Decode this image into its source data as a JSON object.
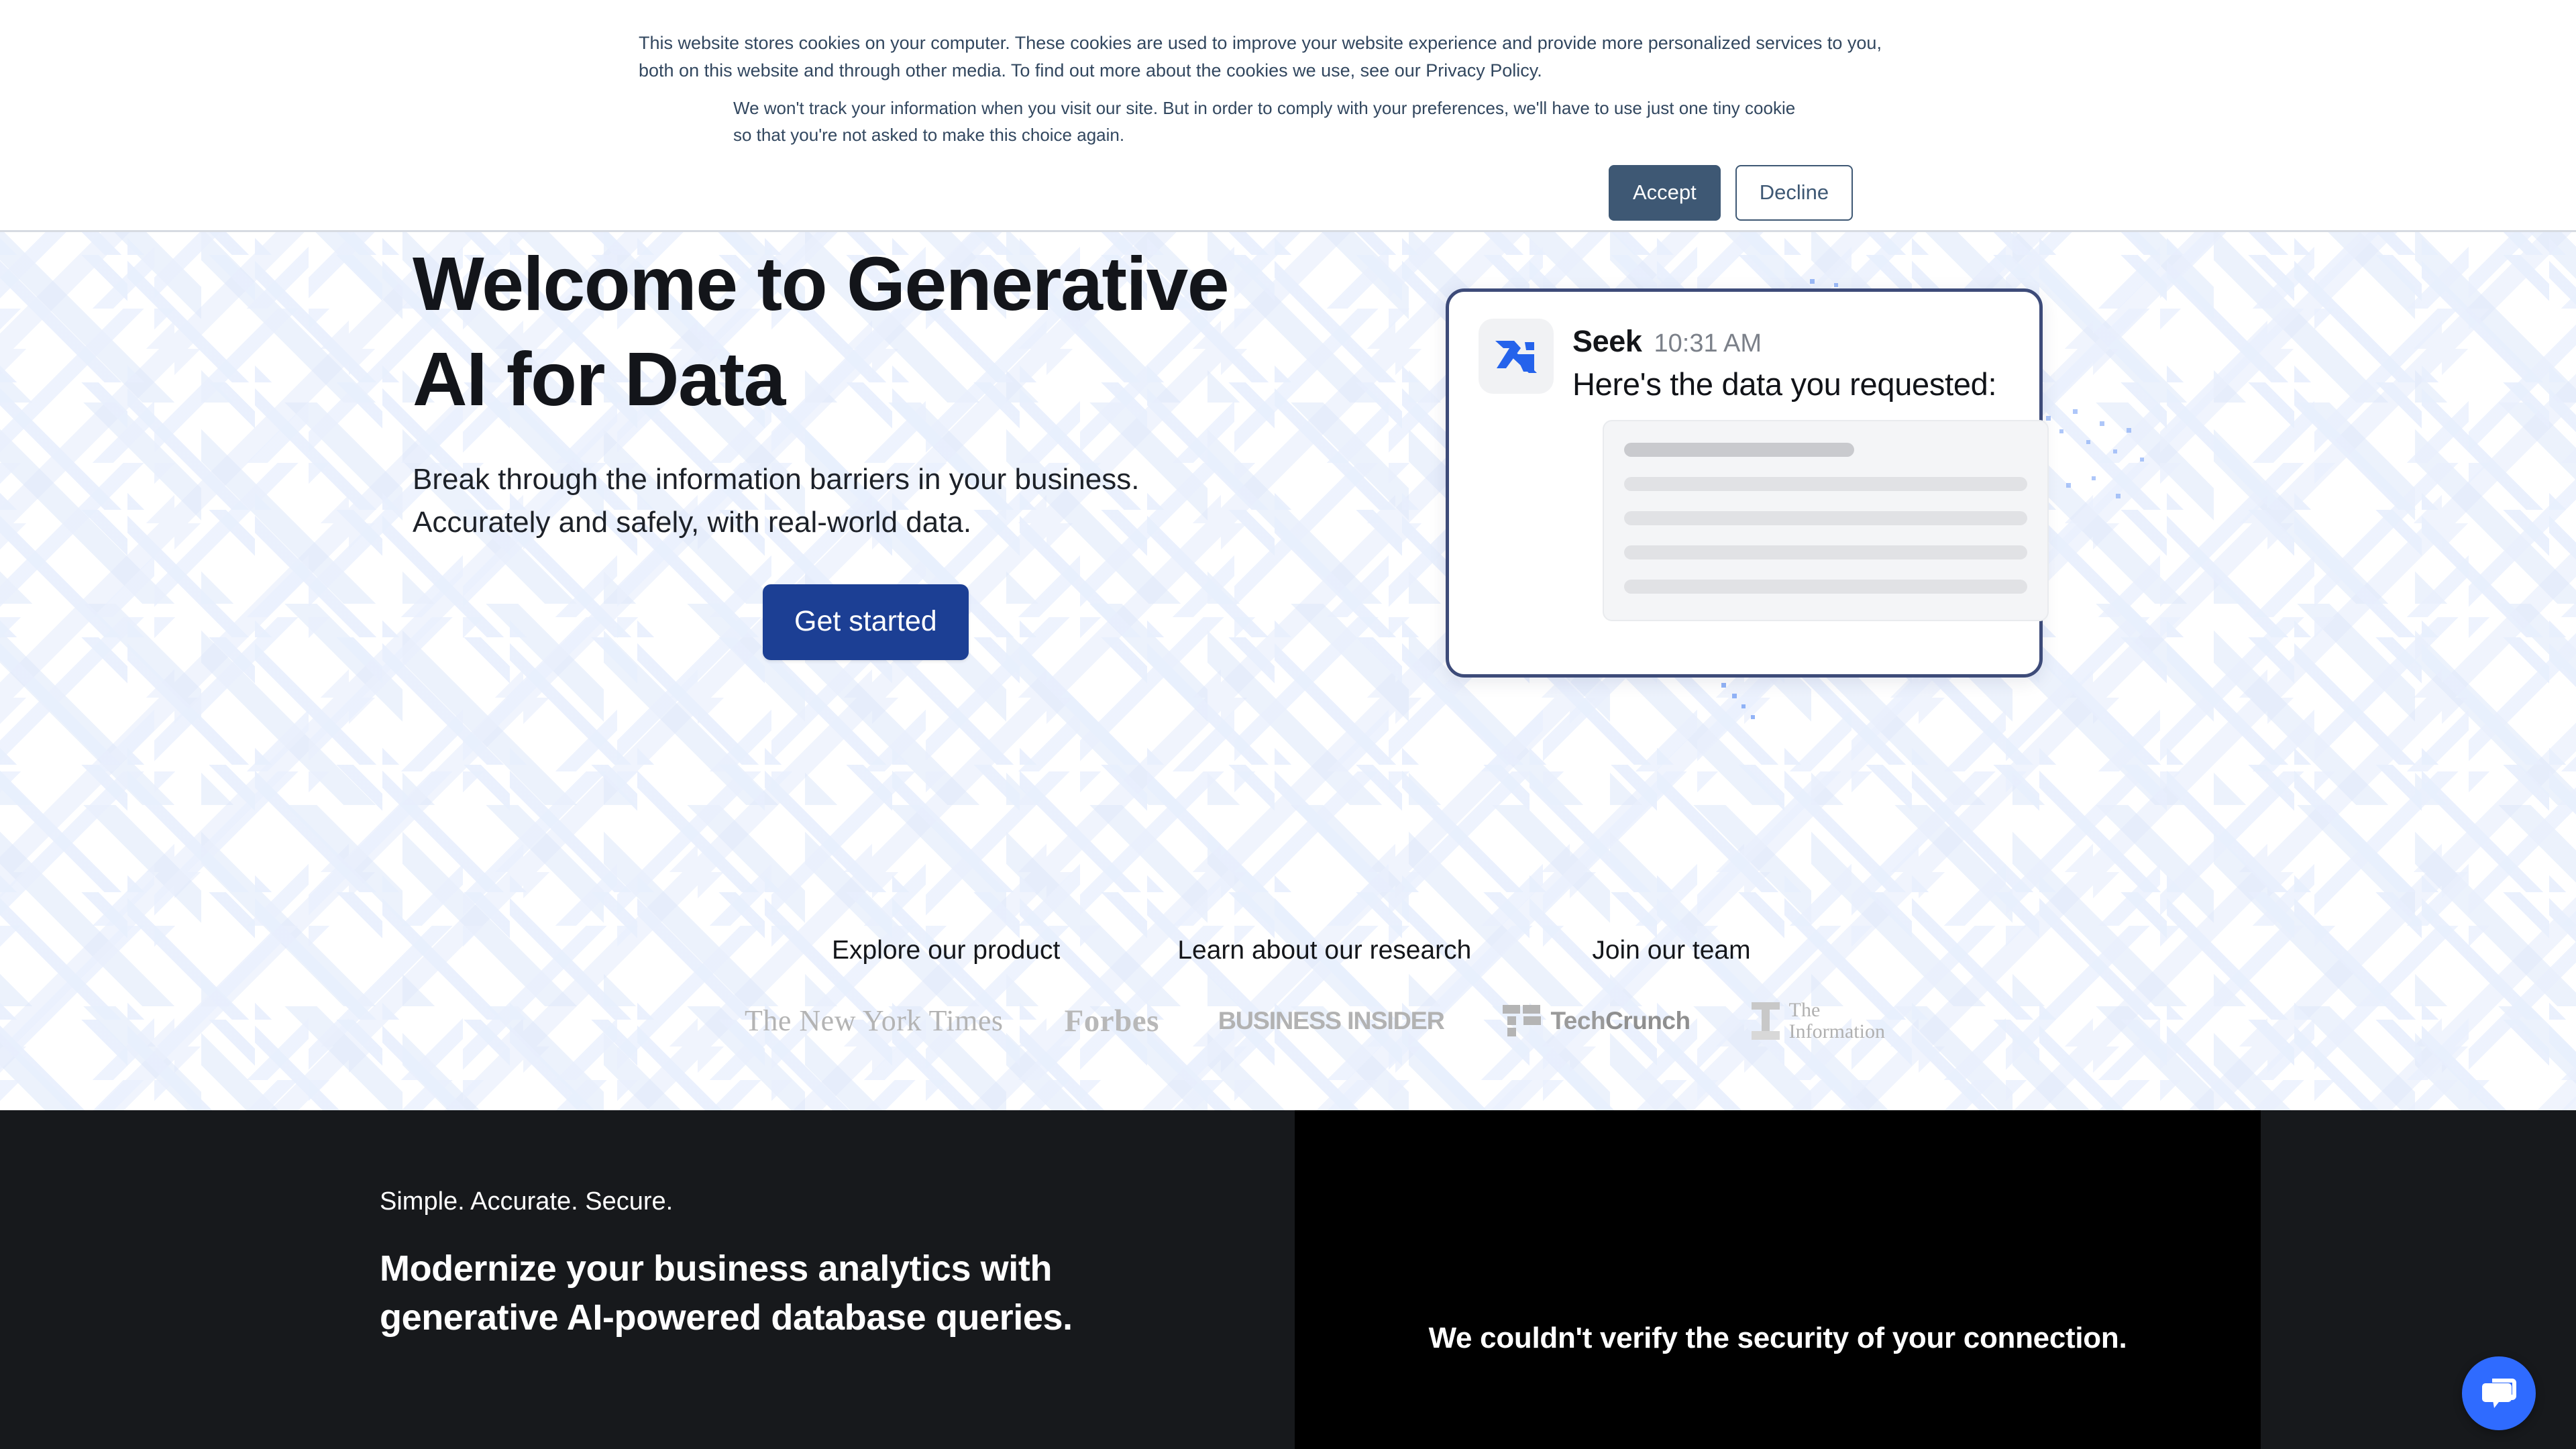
{
  "cookie_banner": {
    "paragraph1": "This website stores cookies on your computer. These cookies are used to improve your website experience and provide more personalized services to you, both on this website and through other media. To find out more about the cookies we use, see our Privacy Policy.",
    "paragraph2": "We won't track your information when you visit our site. But in order to comply with your preferences, we'll have to use just one tiny cookie so that you're not asked to make this choice again.",
    "accept_label": "Accept",
    "decline_label": "Decline",
    "accept_color": "#3e5874"
  },
  "hero": {
    "title": "Welcome to Generative AI for Data",
    "subtitle_line1": "Break through the information barriers in your business.",
    "subtitle_line2": "Accurately and safely, with real-world data.",
    "cta_label": "Get started",
    "cta_color": "#1c3f94",
    "links": [
      {
        "label": "Explore our product"
      },
      {
        "label": "Learn about our research"
      },
      {
        "label": "Join our team"
      }
    ],
    "press_logos": [
      {
        "name": "The New York Times",
        "text": "The New York Times"
      },
      {
        "name": "Forbes",
        "text": "Forbes"
      },
      {
        "name": "Business Insider",
        "text": "BUSINESS INSIDER"
      },
      {
        "name": "TechCrunch",
        "text_light": "Tech",
        "text_bold": "Crunch"
      },
      {
        "name": "The Information",
        "line1": "The",
        "line2": "Information"
      }
    ]
  },
  "chat_card": {
    "sender": "Seek",
    "time": "10:31 AM",
    "message": "Here's the data you requested:",
    "logo_name": "seek-logo",
    "logo_color": "#2563eb",
    "border_color": "#3d4b79",
    "skeleton_rows": 5
  },
  "dark_section": {
    "eyebrow": "Simple. Accurate. Secure.",
    "title_line1": "Modernize your business analytics with",
    "title_line2": "generative AI-powered database queries.",
    "background_color": "#17191c"
  },
  "video_panel": {
    "error_message": "We couldn't verify the security of your connection.",
    "background_color": "#000000"
  },
  "chat_widget": {
    "icon_name": "chat-bubbles-icon",
    "color": "#2f6bff"
  }
}
